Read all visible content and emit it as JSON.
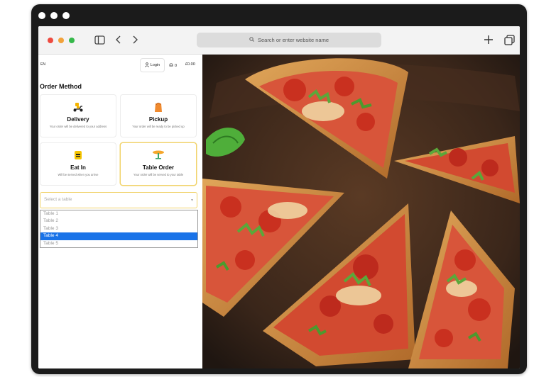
{
  "browser": {
    "url_placeholder": "Search or enter website name",
    "icons": [
      "sidebar-icon",
      "back-icon",
      "forward-icon",
      "search-icon",
      "new-tab-icon",
      "tabs-overview-icon"
    ]
  },
  "header": {
    "language": "EN",
    "login_label": "Login",
    "notification_count": "0",
    "cart_total": "£0.00"
  },
  "order_method": {
    "title": "Order Method",
    "options": [
      {
        "label": "Delivery",
        "description": "Your order will be delivered to your address",
        "icon": "delivery-scooter-icon"
      },
      {
        "label": "Pickup",
        "description": "Your order will be ready to be picked up",
        "icon": "pickup-bag-icon"
      },
      {
        "label": "Eat In",
        "description": "Will be served when you arrive",
        "icon": "eat-in-icon"
      },
      {
        "label": "Table Order",
        "description": "Your order will be served to your table",
        "icon": "table-icon"
      }
    ],
    "selected": "Table Order"
  },
  "table_select": {
    "placeholder": "Select a table",
    "options": [
      "Table 1",
      "Table 2",
      "Table 3",
      "Table 4",
      "Table 5"
    ],
    "highlighted": "Table 4"
  },
  "colors": {
    "accent_yellow": "#f1d36b",
    "highlight_blue": "#1a73e8",
    "device_frame": "#1b1b1b"
  }
}
